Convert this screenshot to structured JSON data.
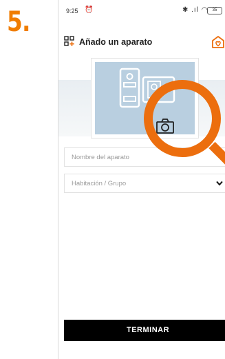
{
  "step": {
    "number": "5."
  },
  "status_bar": {
    "time": "9:25",
    "alarm_glyph": "⏰",
    "signal_glyphs": "✱ .ıl ◠",
    "battery": "35"
  },
  "header": {
    "title": "Añado un aparato",
    "left_icon": "add-device-icon",
    "right_icon": "home-icon"
  },
  "form": {
    "name_placeholder": "Nombre del aparato",
    "room_placeholder": "Habitación / Grupo"
  },
  "finish_button": {
    "label": "TERMINAR"
  },
  "colors": {
    "accent_orange": "#ec6e0e",
    "photo_background": "#b9cfe0",
    "button_background": "#000000"
  }
}
